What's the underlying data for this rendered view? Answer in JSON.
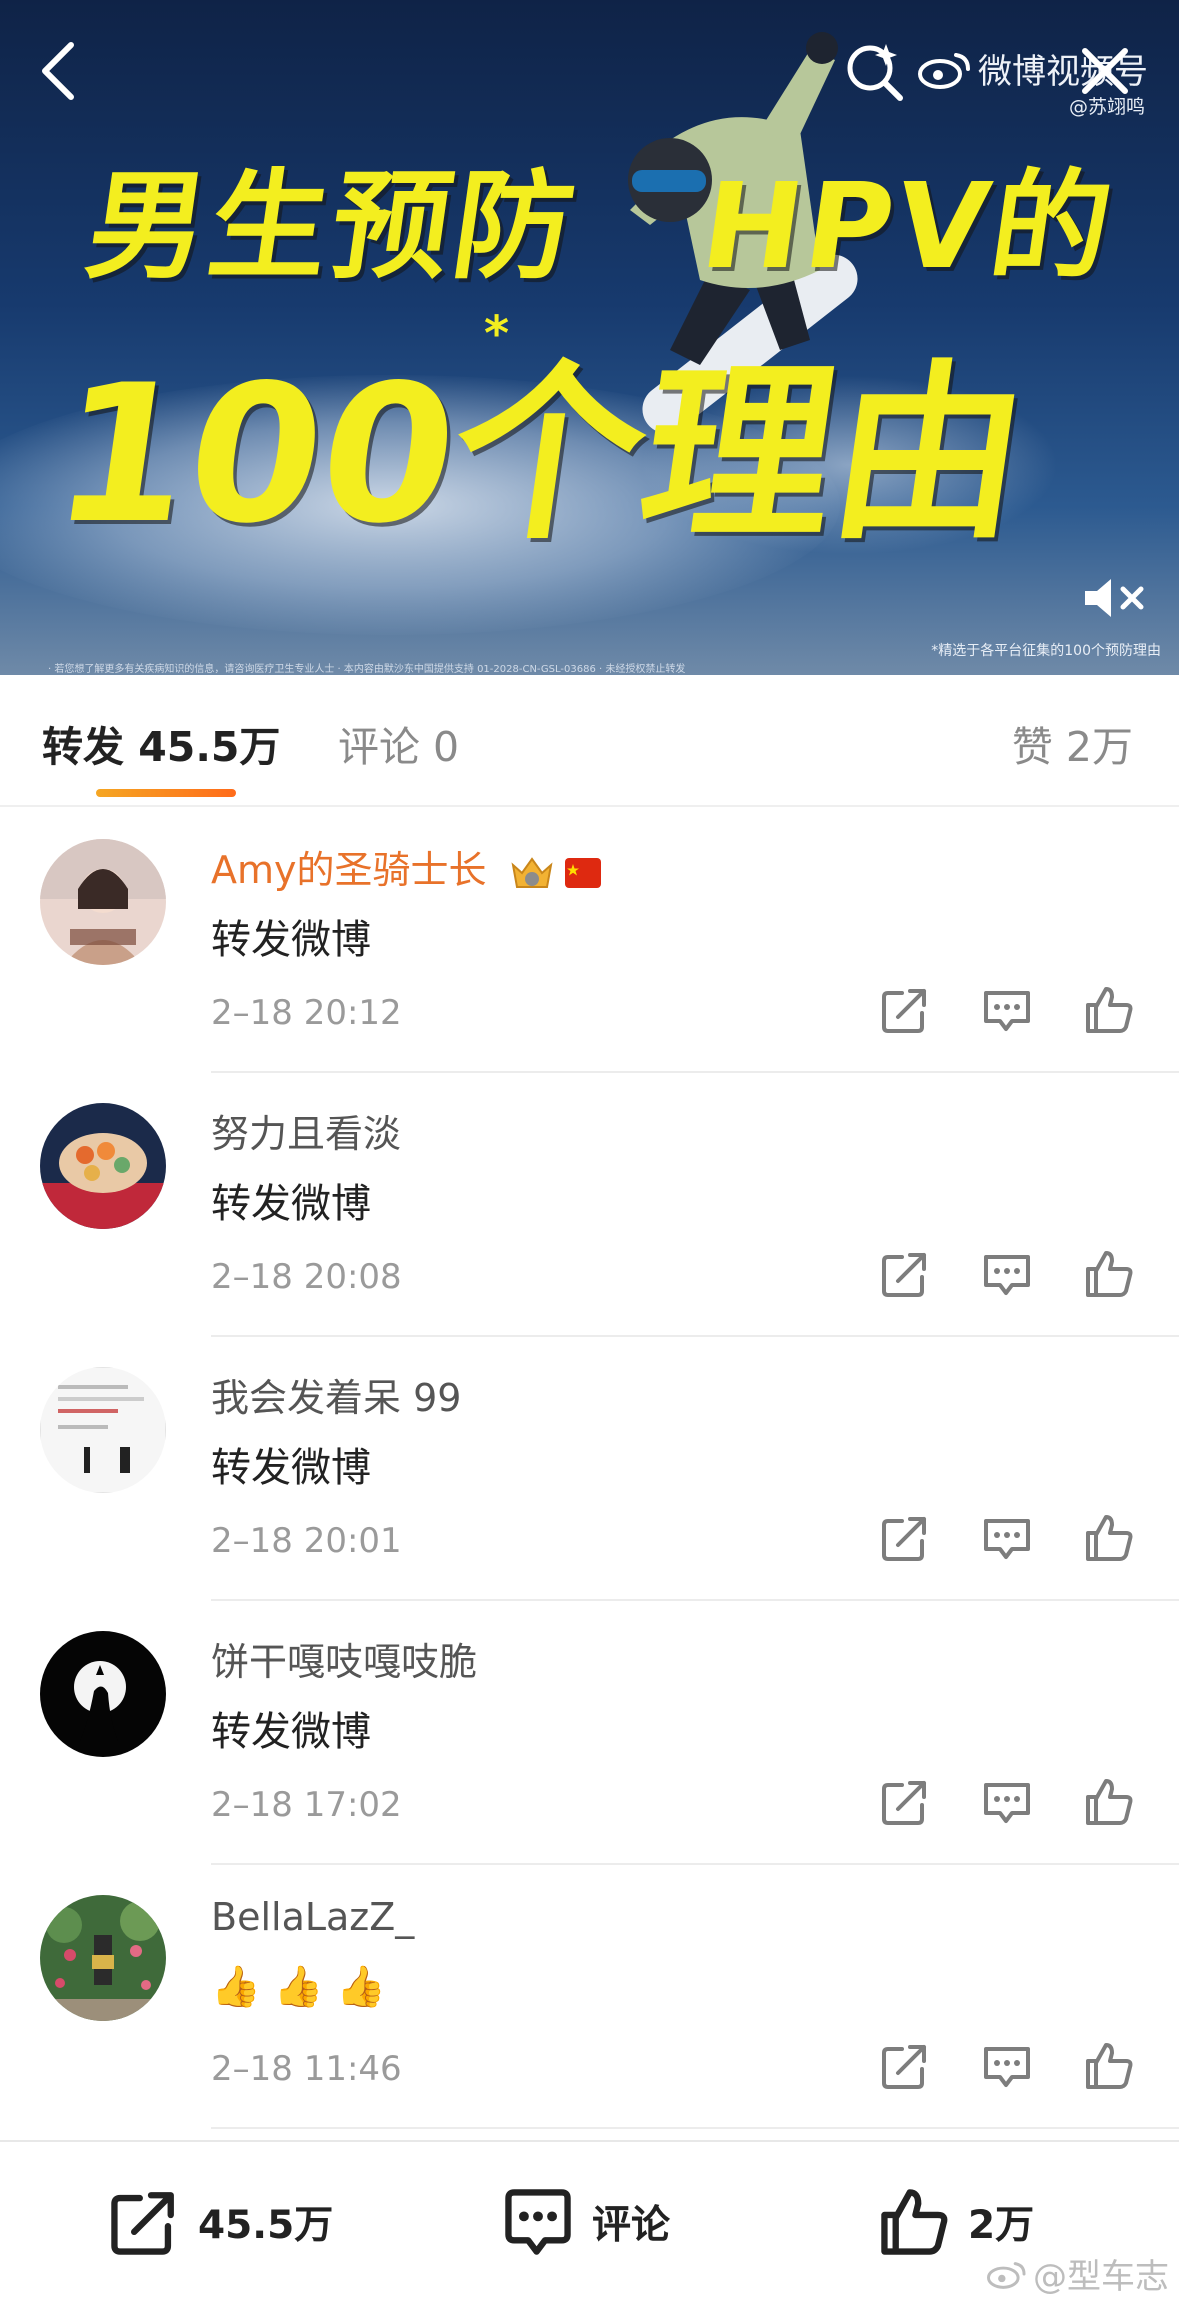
{
  "banner": {
    "headline_line1_left": "男生预防",
    "headline_line1_right": "HPV的",
    "headline_line2": "100个理由",
    "headline_asterisk": "*",
    "brand": "微博视频号",
    "handle": "@苏翊鸣",
    "footnote": "*精选于各平台征集的100个预防理由",
    "disclaimer": "· 若您想了解更多有关疾病知识的信息，请咨询医疗卫生专业人士 · 本内容由默沙东中国提供支持 01-2028-CN-GSL-03686 · 未经授权禁止转发"
  },
  "tabs": {
    "repost": "转发 45.5万",
    "comments": "评论 0",
    "likes": "赞 2万"
  },
  "reposts": [
    {
      "name": "Amy的圣骑士长",
      "text": "转发微博",
      "time": "2–18 20:12",
      "vip": true
    },
    {
      "name": "努力且看淡",
      "text": "转发微博",
      "time": "2–18 20:08",
      "vip": false
    },
    {
      "name": "我会发着呆 99",
      "text": "转发微博",
      "time": "2–18 20:01",
      "vip": false
    },
    {
      "name": "饼干嘎吱嘎吱脆",
      "text": "转发微博",
      "time": "2–18 17:02",
      "vip": false
    },
    {
      "name": "BellaLazZ_",
      "text": "👍 👍 👍",
      "time": "2–18 11:46",
      "vip": false
    }
  ],
  "bottom_bar": {
    "repost": "45.5万",
    "comment": "评论",
    "like": "2万"
  },
  "watermark": "@型车志",
  "colors": {
    "accent_orange": "#ff6b1a",
    "headline_yellow": "#f3ee1f",
    "vip_name": "#e8722a"
  }
}
